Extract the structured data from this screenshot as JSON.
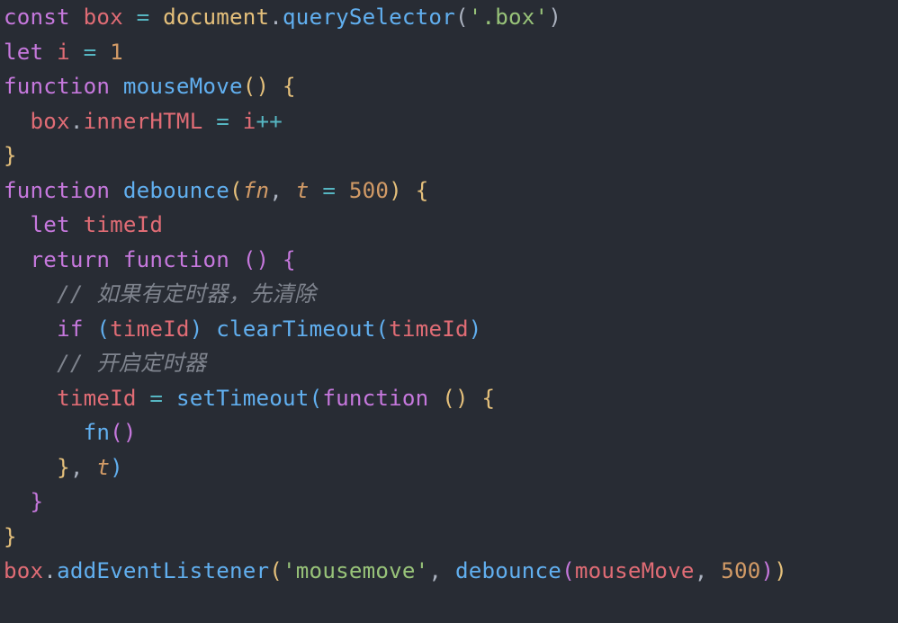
{
  "code": {
    "lines": [
      {
        "indent": 0,
        "tokens": [
          {
            "t": "const ",
            "c": "tok-kw"
          },
          {
            "t": "box",
            "c": "tok-var"
          },
          {
            "t": " ",
            "c": "tok-punc"
          },
          {
            "t": "=",
            "c": "tok-op"
          },
          {
            "t": " ",
            "c": "tok-punc"
          },
          {
            "t": "document",
            "c": "tok-builtin"
          },
          {
            "t": ".",
            "c": "tok-punc"
          },
          {
            "t": "querySelector",
            "c": "tok-fn"
          },
          {
            "t": "(",
            "c": "tok-punc"
          },
          {
            "t": "'.box'",
            "c": "tok-str"
          },
          {
            "t": ")",
            "c": "tok-punc"
          }
        ]
      },
      {
        "indent": 0,
        "tokens": [
          {
            "t": "let ",
            "c": "tok-kw"
          },
          {
            "t": "i",
            "c": "tok-var"
          },
          {
            "t": " ",
            "c": "tok-punc"
          },
          {
            "t": "=",
            "c": "tok-op"
          },
          {
            "t": " ",
            "c": "tok-punc"
          },
          {
            "t": "1",
            "c": "tok-num"
          }
        ]
      },
      {
        "indent": 0,
        "tokens": [
          {
            "t": "function ",
            "c": "tok-kw"
          },
          {
            "t": "mouseMove",
            "c": "tok-fn"
          },
          {
            "t": "(",
            "c": "tok-yellow"
          },
          {
            "t": ")",
            "c": "tok-yellow"
          },
          {
            "t": " ",
            "c": "tok-punc"
          },
          {
            "t": "{",
            "c": "tok-yellow"
          }
        ]
      },
      {
        "indent": 1,
        "tokens": [
          {
            "t": "box",
            "c": "tok-var"
          },
          {
            "t": ".",
            "c": "tok-punc"
          },
          {
            "t": "innerHTML",
            "c": "tok-prop"
          },
          {
            "t": " ",
            "c": "tok-punc"
          },
          {
            "t": "=",
            "c": "tok-op"
          },
          {
            "t": " ",
            "c": "tok-punc"
          },
          {
            "t": "i",
            "c": "tok-var"
          },
          {
            "t": "++",
            "c": "tok-op"
          }
        ]
      },
      {
        "indent": 0,
        "tokens": [
          {
            "t": "}",
            "c": "tok-yellow"
          }
        ]
      },
      {
        "indent": 0,
        "tokens": [
          {
            "t": "function ",
            "c": "tok-kw"
          },
          {
            "t": "debounce",
            "c": "tok-fn"
          },
          {
            "t": "(",
            "c": "tok-yellow"
          },
          {
            "t": "fn",
            "c": "tok-param"
          },
          {
            "t": ", ",
            "c": "tok-punc"
          },
          {
            "t": "t",
            "c": "tok-param"
          },
          {
            "t": " ",
            "c": "tok-punc"
          },
          {
            "t": "=",
            "c": "tok-op"
          },
          {
            "t": " ",
            "c": "tok-punc"
          },
          {
            "t": "500",
            "c": "tok-num"
          },
          {
            "t": ")",
            "c": "tok-yellow"
          },
          {
            "t": " ",
            "c": "tok-punc"
          },
          {
            "t": "{",
            "c": "tok-yellow"
          }
        ]
      },
      {
        "indent": 1,
        "tokens": [
          {
            "t": "let ",
            "c": "tok-kw"
          },
          {
            "t": "timeId",
            "c": "tok-var"
          }
        ]
      },
      {
        "indent": 1,
        "tokens": [
          {
            "t": "return ",
            "c": "tok-kw"
          },
          {
            "t": "function ",
            "c": "tok-kw"
          },
          {
            "t": "(",
            "c": "tok-ppunc"
          },
          {
            "t": ")",
            "c": "tok-ppunc"
          },
          {
            "t": " ",
            "c": "tok-punc"
          },
          {
            "t": "{",
            "c": "tok-ppunc"
          }
        ]
      },
      {
        "indent": 2,
        "tokens": [
          {
            "t": "// 如果有定时器，先清除",
            "c": "tok-comment"
          }
        ]
      },
      {
        "indent": 2,
        "tokens": [
          {
            "t": "if ",
            "c": "tok-kw"
          },
          {
            "t": "(",
            "c": "tok-fn"
          },
          {
            "t": "timeId",
            "c": "tok-var"
          },
          {
            "t": ")",
            "c": "tok-fn"
          },
          {
            "t": " ",
            "c": "tok-punc"
          },
          {
            "t": "clearTimeout",
            "c": "tok-fn"
          },
          {
            "t": "(",
            "c": "tok-fn"
          },
          {
            "t": "timeId",
            "c": "tok-var"
          },
          {
            "t": ")",
            "c": "tok-fn"
          }
        ]
      },
      {
        "indent": 2,
        "tokens": [
          {
            "t": "// 开启定时器",
            "c": "tok-comment"
          }
        ]
      },
      {
        "indent": 2,
        "tokens": [
          {
            "t": "timeId",
            "c": "tok-var"
          },
          {
            "t": " ",
            "c": "tok-punc"
          },
          {
            "t": "=",
            "c": "tok-op"
          },
          {
            "t": " ",
            "c": "tok-punc"
          },
          {
            "t": "setTimeout",
            "c": "tok-fn"
          },
          {
            "t": "(",
            "c": "tok-fn"
          },
          {
            "t": "function ",
            "c": "tok-kw"
          },
          {
            "t": "(",
            "c": "tok-yellow"
          },
          {
            "t": ")",
            "c": "tok-yellow"
          },
          {
            "t": " ",
            "c": "tok-punc"
          },
          {
            "t": "{",
            "c": "tok-yellow"
          }
        ]
      },
      {
        "indent": 3,
        "tokens": [
          {
            "t": "fn",
            "c": "tok-fn"
          },
          {
            "t": "(",
            "c": "tok-ppunc"
          },
          {
            "t": ")",
            "c": "tok-ppunc"
          }
        ]
      },
      {
        "indent": 2,
        "tokens": [
          {
            "t": "}",
            "c": "tok-yellow"
          },
          {
            "t": ", ",
            "c": "tok-punc"
          },
          {
            "t": "t",
            "c": "tok-param"
          },
          {
            "t": ")",
            "c": "tok-fn"
          }
        ]
      },
      {
        "indent": 1,
        "tokens": [
          {
            "t": "}",
            "c": "tok-ppunc"
          }
        ]
      },
      {
        "indent": 0,
        "tokens": [
          {
            "t": "}",
            "c": "tok-yellow"
          }
        ]
      },
      {
        "indent": 0,
        "tokens": [
          {
            "t": "box",
            "c": "tok-var"
          },
          {
            "t": ".",
            "c": "tok-punc"
          },
          {
            "t": "addEventListener",
            "c": "tok-fn"
          },
          {
            "t": "(",
            "c": "tok-yellow"
          },
          {
            "t": "'mousemove'",
            "c": "tok-str"
          },
          {
            "t": ", ",
            "c": "tok-punc"
          },
          {
            "t": "debounce",
            "c": "tok-fn"
          },
          {
            "t": "(",
            "c": "tok-ppunc"
          },
          {
            "t": "mouseMove",
            "c": "tok-var"
          },
          {
            "t": ", ",
            "c": "tok-punc"
          },
          {
            "t": "500",
            "c": "tok-num"
          },
          {
            "t": ")",
            "c": "tok-ppunc"
          },
          {
            "t": ")",
            "c": "tok-yellow"
          }
        ]
      }
    ],
    "indent_unit": "  "
  }
}
